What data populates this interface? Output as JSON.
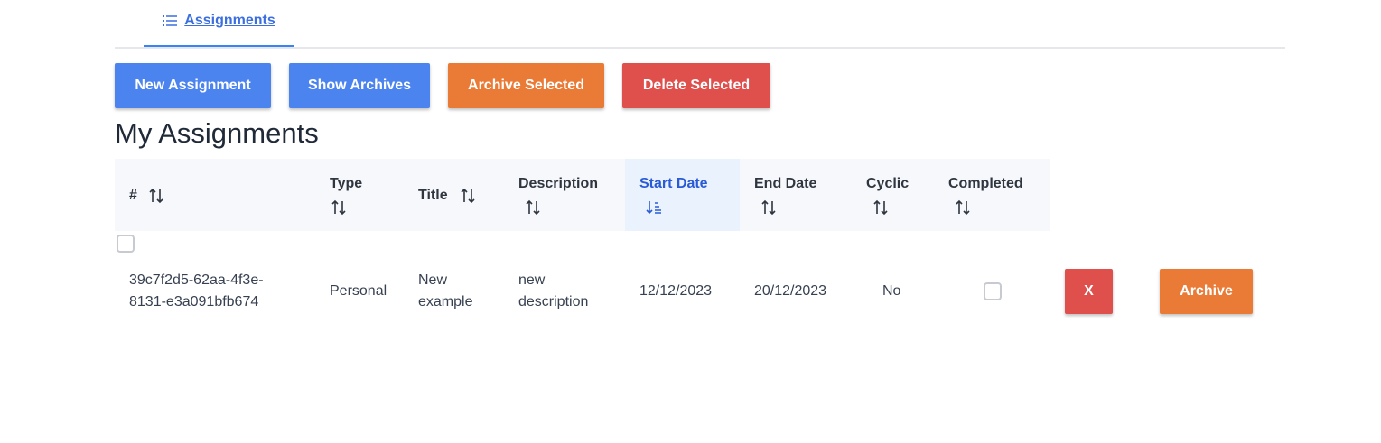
{
  "tabs": {
    "assignments_label": "Assignments",
    "icon": "list-icon"
  },
  "toolbar": {
    "new_assignment": "New Assignment",
    "show_archives": "Show Archives",
    "archive_selected": "Archive Selected",
    "delete_selected": "Delete Selected"
  },
  "page_title": "My Assignments",
  "table": {
    "headers": {
      "id": "#",
      "type": "Type",
      "title": "Title",
      "description": "Description",
      "start_date": "Start Date",
      "end_date": "End Date",
      "cyclic": "Cyclic",
      "completed": "Completed"
    },
    "sorted_column": "start_date",
    "rows": [
      {
        "id_line1": "39c7f2d5-62aa-4f3e-",
        "id_line2": "8131-e3a091bfb674",
        "type": "Personal",
        "title_line1": "New",
        "title_line2": "example",
        "description_line1": "new",
        "description_line2": "description",
        "start_date": "12/12/2023",
        "end_date": "20/12/2023",
        "cyclic": "No",
        "completed": false,
        "delete_label": "X",
        "archive_label": "Archive"
      }
    ]
  },
  "colors": {
    "primary_blue": "#4c84ef",
    "orange": "#ea7b36",
    "red": "#df4f4b",
    "link_blue": "#3b6fe0",
    "sorted_header_bg": "#eaf2fe"
  }
}
